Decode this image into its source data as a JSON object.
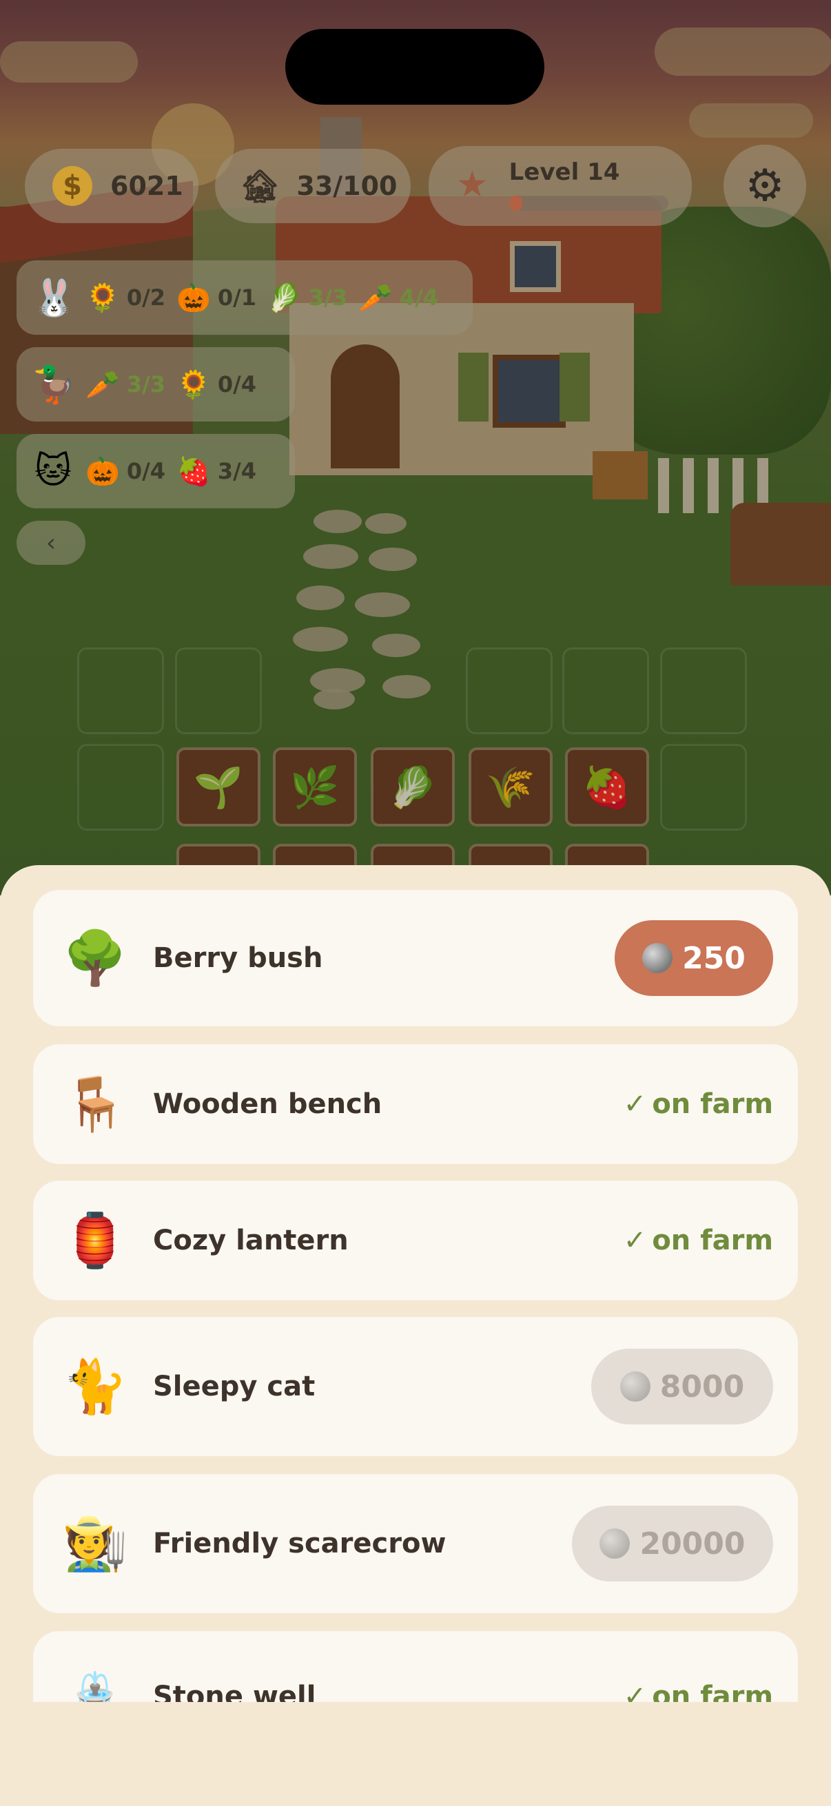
{
  "hud": {
    "coins": "6021",
    "coin_symbol": "$",
    "storage": "33/100",
    "level_label": "Level 14",
    "level_progress": 0.08
  },
  "orders": [
    {
      "customer_icon": "bunny-icon",
      "requirements": [
        {
          "icon": "sunflower-icon",
          "count": "0/2"
        },
        {
          "icon": "pumpkin-icon",
          "count": "0/1"
        },
        {
          "icon": "lettuce-icon",
          "count": "3/3"
        },
        {
          "icon": "carrot-icon",
          "count": "4/4"
        }
      ]
    },
    {
      "customer_icon": "scarecrow-duck-icon",
      "requirements": [
        {
          "icon": "carrot-icon",
          "count": "3/3"
        },
        {
          "icon": "sunflower-icon",
          "count": "0/4"
        }
      ]
    },
    {
      "customer_icon": "cat-icon",
      "requirements": [
        {
          "icon": "pumpkin-icon",
          "count": "0/4"
        },
        {
          "icon": "strawberry-icon",
          "count": "3/4"
        }
      ]
    }
  ],
  "collapse_icon": "‹",
  "shop": {
    "owned_label": "on farm",
    "owned_check": "✓",
    "items": [
      {
        "name": "Berry bush",
        "icon": "berry-bush-icon",
        "price": "250",
        "state": "afford"
      },
      {
        "name": "Wooden bench",
        "icon": "bench-icon",
        "state": "owned"
      },
      {
        "name": "Cozy lantern",
        "icon": "lantern-icon",
        "state": "owned"
      },
      {
        "name": "Sleepy cat",
        "icon": "sleepy-cat-icon",
        "price": "8000",
        "state": "locked"
      },
      {
        "name": "Friendly scarecrow",
        "icon": "scarecrow-icon",
        "price": "20000",
        "state": "locked"
      },
      {
        "name": "Stone well",
        "icon": "well-icon",
        "state": "owned"
      }
    ]
  },
  "colors": {
    "accent": "#c97556",
    "owned_green": "#6f8c3c",
    "sheet_bg": "#f4e8d3",
    "card_bg": "#fbf7f1"
  }
}
